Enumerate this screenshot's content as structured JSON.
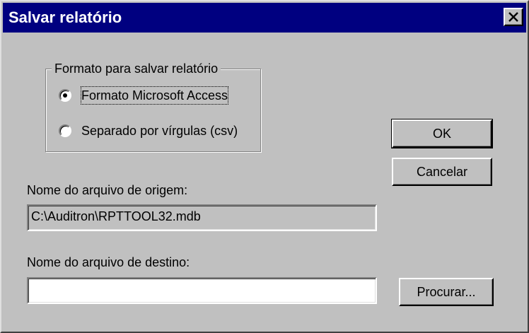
{
  "dialog": {
    "title": "Salvar relatório"
  },
  "format_group": {
    "legend": "Formato para salvar relatório",
    "options": [
      {
        "label": "Formato Microsoft Access",
        "selected": true
      },
      {
        "label": "Separado por vírgulas (csv)",
        "selected": false
      }
    ]
  },
  "source": {
    "label": "Nome do arquivo de origem:",
    "value": "C:\\Auditron\\RPTTOOL32.mdb"
  },
  "destination": {
    "label": "Nome do arquivo de destino:",
    "value": ""
  },
  "buttons": {
    "ok": "OK",
    "cancel": "Cancelar",
    "browse": "Procurar..."
  },
  "icons": {
    "close": "close-icon"
  },
  "colors": {
    "titlebar": "#000080",
    "face": "#c0c0c0"
  }
}
